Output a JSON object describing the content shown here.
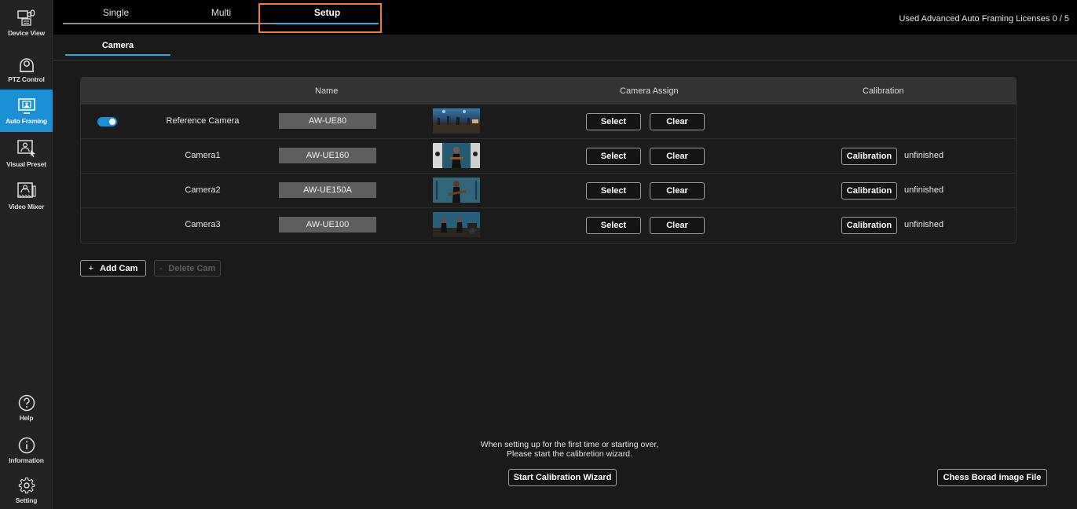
{
  "sidebar": {
    "items": [
      {
        "label": "Device View",
        "icon": "device-view-icon"
      },
      {
        "label": "PTZ Control",
        "icon": "ptz-camera-icon"
      },
      {
        "label": "Auto Framing",
        "icon": "auto-framing-icon",
        "active": true
      },
      {
        "label": "Visual Preset",
        "icon": "visual-preset-icon"
      },
      {
        "label": "Video Mixer",
        "icon": "video-mixer-icon"
      }
    ],
    "bottom_items": [
      {
        "label": "Help",
        "icon": "help-icon"
      },
      {
        "label": "Information",
        "icon": "info-icon"
      },
      {
        "label": "Setting",
        "icon": "gear-icon"
      }
    ]
  },
  "tabs": [
    {
      "label": "Single"
    },
    {
      "label": "Multi"
    },
    {
      "label": "Setup",
      "active": true
    }
  ],
  "license_text": "Used Advanced Auto Framing Licenses  0 / 5",
  "subtab": {
    "label": "Camera"
  },
  "table": {
    "headers": {
      "name": "Name",
      "assign": "Camera Assign",
      "calibration": "Calibration"
    },
    "rows": [
      {
        "name": "Reference Camera",
        "model": "AW-UE80",
        "select": "Select",
        "clear": "Clear",
        "reference": true,
        "toggle_on": true
      },
      {
        "name": "Camera1",
        "model": "AW-UE160",
        "select": "Select",
        "clear": "Clear",
        "calibration": "Calibration",
        "status": "unfinished"
      },
      {
        "name": "Camera2",
        "model": "AW-UE150A",
        "select": "Select",
        "clear": "Clear",
        "calibration": "Calibration",
        "status": "unfinished"
      },
      {
        "name": "Camera3",
        "model": "AW-UE100",
        "select": "Select",
        "clear": "Clear",
        "calibration": "Calibration",
        "status": "unfinished"
      }
    ]
  },
  "buttons": {
    "add_cam_symbol": "+",
    "add_cam": "Add Cam",
    "delete_cam_symbol": "-",
    "delete_cam": "Delete Cam",
    "wizard": "Start Calibration Wizard",
    "chess": "Chess Borad image File"
  },
  "hint": {
    "line1": "When setting up for the first time or starting over,",
    "line2": "Please start the calibretion wizard."
  },
  "colors": {
    "accent": "#29a8e8",
    "active_side": "#1b8fd6",
    "highlight": "#f07d2e"
  }
}
